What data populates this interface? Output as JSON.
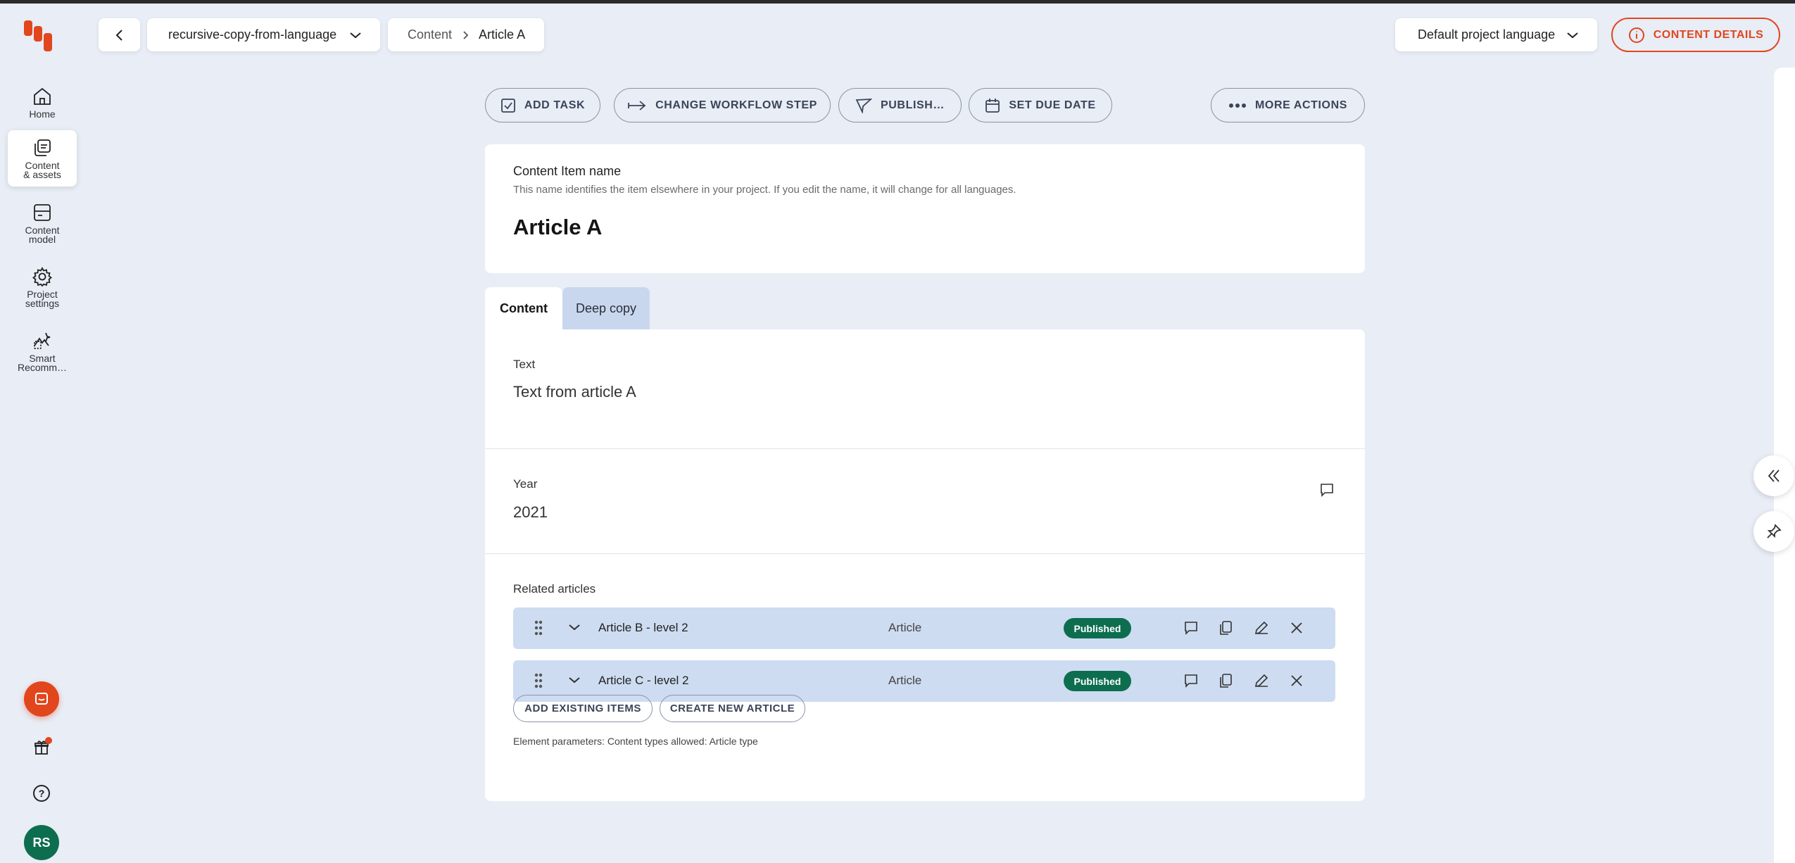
{
  "sidebar": {
    "items": [
      {
        "label": "Home",
        "icon": "home-icon"
      },
      {
        "label": "Content & assets",
        "line1": "Content",
        "line2": "& assets",
        "icon": "content-assets-icon",
        "active": true
      },
      {
        "label": "Content model",
        "line1": "Content",
        "line2": "model",
        "icon": "content-model-icon"
      },
      {
        "label": "Project settings",
        "line1": "Project",
        "line2": "settings",
        "icon": "settings-gear-icon"
      },
      {
        "label": "Smart Recomm...",
        "line1": "Smart",
        "line2": "Recomm…",
        "icon": "smart-recommendations-icon"
      }
    ],
    "avatar_initials": "RS"
  },
  "topbar": {
    "project": "recursive-copy-from-language",
    "breadcrumb": [
      "Content",
      "Article A"
    ],
    "language": "Default project language",
    "content_details": "CONTENT DETAILS"
  },
  "actions": {
    "add_task": "ADD TASK",
    "change_workflow": "CHANGE WORKFLOW STEP",
    "publish": "PUBLISH…",
    "set_due_date": "SET DUE DATE",
    "more_actions": "MORE ACTIONS"
  },
  "item": {
    "name_label": "Content Item name",
    "name_hint": "This name identifies the item elsewhere in your project. If you edit the name, it will change for all languages.",
    "name": "Article A"
  },
  "tabs": [
    "Content",
    "Deep copy"
  ],
  "elements": {
    "text_label": "Text",
    "text_value": "Text from article A",
    "year_label": "Year",
    "year_value": "2021",
    "related_label": "Related articles",
    "related": [
      {
        "name": "Article B - level 2",
        "type": "Article",
        "status": "Published"
      },
      {
        "name": "Article C - level 2",
        "type": "Article",
        "status": "Published"
      }
    ],
    "add_existing": "ADD EXISTING ITEMS",
    "create_new": "CREATE NEW ARTICLE",
    "params": "Element parameters: Content types allowed: Article type"
  },
  "colors": {
    "brand": "#e2461d",
    "published": "#0d6e4f",
    "background": "#e8edf6",
    "row": "#cddcf1"
  }
}
